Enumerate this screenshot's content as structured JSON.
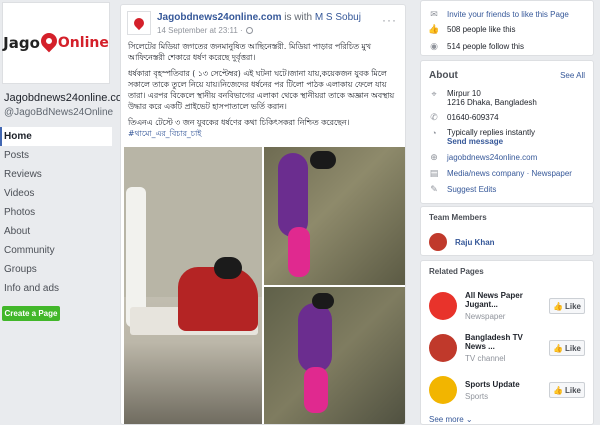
{
  "page": {
    "logo_jago": "Jago",
    "logo_online": "Online",
    "name": "Jagobdnews24online.com",
    "handle": "@JagoBdNews24Online"
  },
  "nav": {
    "items": [
      {
        "label": "Home",
        "active": true
      },
      {
        "label": "Posts"
      },
      {
        "label": "Reviews"
      },
      {
        "label": "Videos"
      },
      {
        "label": "Photos"
      },
      {
        "label": "About"
      },
      {
        "label": "Community"
      },
      {
        "label": "Groups"
      },
      {
        "label": "Info and ads"
      }
    ],
    "create_page": "Create a Page"
  },
  "post": {
    "author": "Jagobdnews24online.com",
    "with_text": " is with ",
    "tagged": "M S Sobuj",
    "timestamp": "14 September at 23:11 · ",
    "paragraphs": [
      "সিলেটের মিডিয়া জগতের জনমানুষিত আছিনেস্তরী. মিডিয়া পাড়ার পরিচিত মুখ আফিনেস্তরী শেকারে ধর্ষণ করেছে দুর্বৃত্তরা।",
      "ধর্ষকারা বৃহস্পতিবার ( ১৩ সেপ্টেম্বর) এই ঘটনা ঘটে।জানা যায়,কয়েকজন যুবক মিলে সকালে তাকে তুলে নিয়ে যায়।নিজেদের ধর্ষনের পর টিলো পাঠক এলাকায় ফেলে যায় তারা। এরপর বিকেলে স্থানীয় বনবিভাগের এলাকা থেকে স্থানীয়রা তাকে অজ্ঞান অবস্থায় উদ্ধার করে একটি প্রাইভেট হাসপাতালে ভর্তি করান।",
      "তিএনএ টেস্টে ৩ জন যুবকের ধর্ষণের কথা চিকিৎসকরা নিশ্চিত করেছেন।"
    ],
    "hashtag": "#থামো_এর_বিচার_চাই"
  },
  "right": {
    "invite": "Invite your friends to like this Page",
    "likes": "508 people like this",
    "follows": "514 people follow this",
    "about_title": "About",
    "see_all": "See All",
    "address_line1": "Mirpur 10",
    "address_line2": "1216 Dhaka, Bangladesh",
    "phone": "01640-609374",
    "replies": "Typically replies instantly",
    "send_message": "Send message",
    "website": "jagobdnews24online.com",
    "category": "Media/news company · Newspaper",
    "suggest": "Suggest Edits",
    "team_title": "Team Members",
    "team_member": "Raju Khan",
    "related_title": "Related Pages",
    "related": [
      {
        "name": "All News Paper Jugant...",
        "category": "Newspaper",
        "color": "#e8332b"
      },
      {
        "name": "Bangladesh TV News ...",
        "category": "TV channel",
        "color": "#c0392b"
      },
      {
        "name": "Sports Update",
        "category": "Sports",
        "color": "#f2b500"
      }
    ],
    "like_label": "Like",
    "see_more": "See more"
  }
}
